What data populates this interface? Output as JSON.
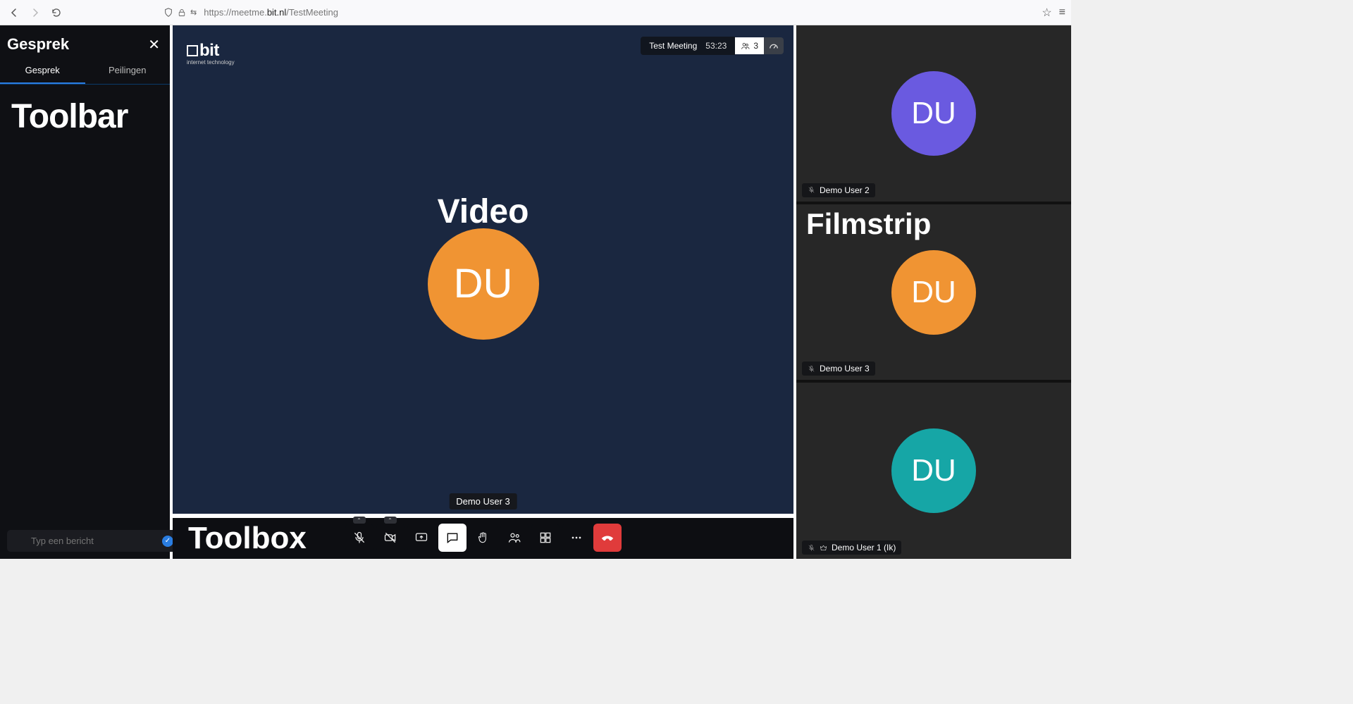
{
  "browser": {
    "url_prefix": "https://meetme.",
    "url_domain": "bit.nl",
    "url_path": "/TestMeeting"
  },
  "sidebar": {
    "title": "Gesprek",
    "tabs": {
      "chat": "Gesprek",
      "polls": "Peilingen"
    },
    "annotation": "Toolbar",
    "input_placeholder": "Typ een bericht"
  },
  "video": {
    "logo_text": "bit",
    "logo_sub": "internet technology",
    "meeting_name": "Test Meeting",
    "elapsed": "53:23",
    "participants_count": "3",
    "annotation": "Video",
    "main_avatar_initials": "DU",
    "main_avatar_color": "#f09433",
    "main_user_name": "Demo User 3"
  },
  "toolbox": {
    "annotation": "Toolbox"
  },
  "filmstrip": {
    "annotation": "Filmstrip",
    "tiles": [
      {
        "initials": "DU",
        "color": "#6a5ae0",
        "name": "Demo User 2",
        "muted": true,
        "mod": false
      },
      {
        "initials": "DU",
        "color": "#f09433",
        "name": "Demo User 3",
        "muted": true,
        "mod": false
      },
      {
        "initials": "DU",
        "color": "#16a6a6",
        "name": "Demo User 1 (Ik)",
        "muted": true,
        "mod": true
      }
    ]
  }
}
